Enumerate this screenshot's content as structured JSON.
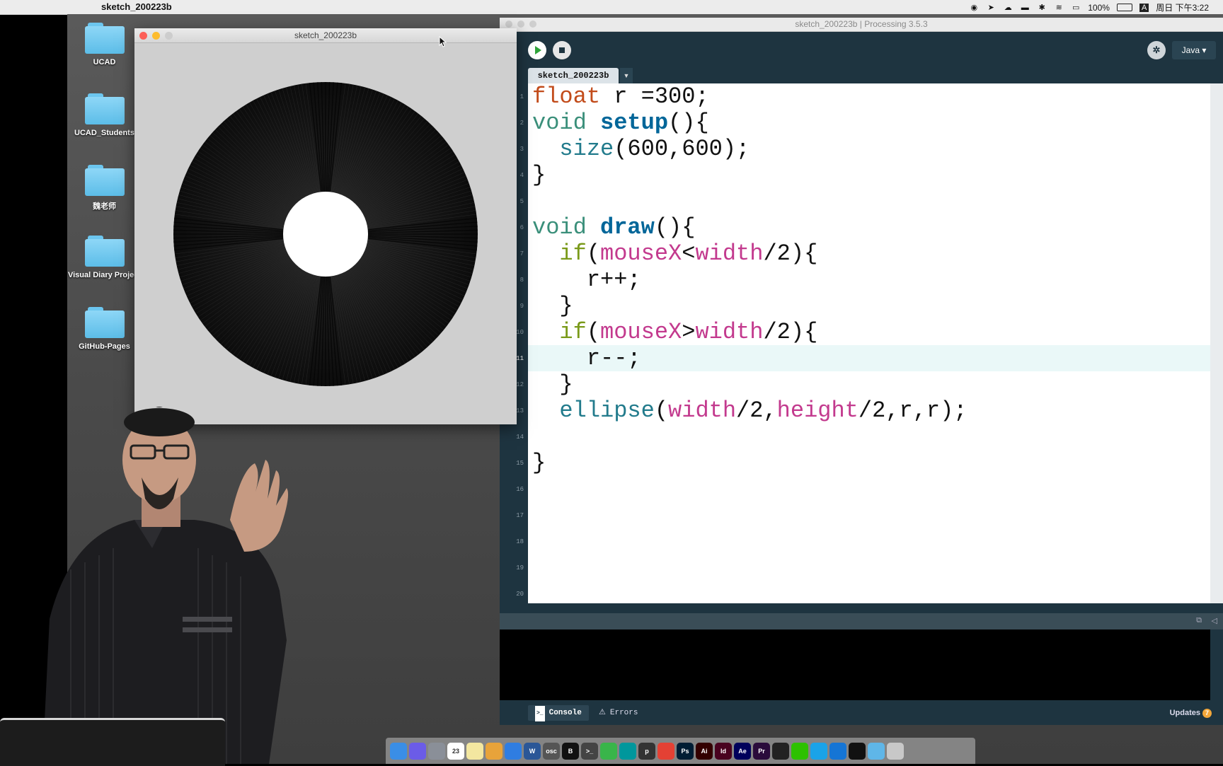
{
  "menubar": {
    "app_name": "sketch_200223b",
    "battery": "100%",
    "input_source": "A",
    "clock": "周日 下午3:22"
  },
  "desktop": {
    "icons": [
      {
        "label": "UCAD"
      },
      {
        "label": "UCAD_Students"
      },
      {
        "label": "魏老师"
      },
      {
        "label": "Visual Diary Project"
      },
      {
        "label": "GitHub-Pages"
      }
    ]
  },
  "sketch_window": {
    "title": "sketch_200223b"
  },
  "pde": {
    "title": "sketch_200223b | Processing 3.5.3",
    "mode": "Java ▾",
    "tab": "sketch_200223b",
    "line_numbers": [
      "1",
      "2",
      "3",
      "4",
      "5",
      "6",
      "7",
      "8",
      "9",
      "10",
      "11",
      "12",
      "13",
      "14",
      "15",
      "16",
      "17",
      "18",
      "19",
      "20"
    ],
    "current_line": 11,
    "code": [
      "float r =300;",
      "void setup(){",
      "  size(600,600);",
      "}",
      "",
      "void draw(){",
      "  if(mouseX<width/2){",
      "    r++;",
      "  }",
      "  if(mouseX>width/2){",
      "    r--;",
      "  }",
      "  ellipse(width/2,height/2,r,r);",
      "",
      "}"
    ],
    "console_tab": "Console",
    "errors_tab": "Errors",
    "updates_label": "Updates",
    "updates_count": "7"
  },
  "dock": {
    "apps": [
      "finder-icon",
      "siri-icon",
      "launchpad-icon",
      "calendar-icon",
      "notes-icon",
      "photos-icon",
      "safari-icon",
      "word-icon",
      "osc-icon",
      "bold-icon",
      "terminal-icon",
      "qq-icon",
      "arduino-icon",
      "p5-icon",
      "chrome-icon",
      "ps-icon",
      "ai-icon",
      "id-icon",
      "ae-icon",
      "pr-icon",
      "github-icon",
      "wechat-icon",
      "qq-penguin-icon",
      "xcode-icon",
      "quicktime-icon",
      "folder-icon",
      "trash-icon"
    ]
  }
}
